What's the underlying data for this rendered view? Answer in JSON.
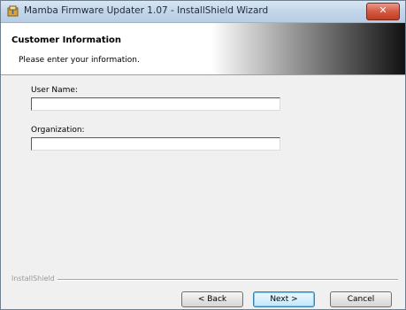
{
  "window": {
    "title": "Mamba Firmware Updater 1.07 - InstallShield Wizard",
    "close_label": "✕"
  },
  "banner": {
    "title": "Customer Information",
    "subtitle": "Please enter your information."
  },
  "form": {
    "user_name_label": "User Name:",
    "user_name_value": "",
    "organization_label": "Organization:",
    "organization_value": ""
  },
  "footer": {
    "brand": "InstallShield",
    "back_label": "< Back",
    "next_label": "Next >",
    "cancel_label": "Cancel"
  },
  "colors": {
    "accent": "#3c7fb1",
    "close": "#c23b22"
  }
}
